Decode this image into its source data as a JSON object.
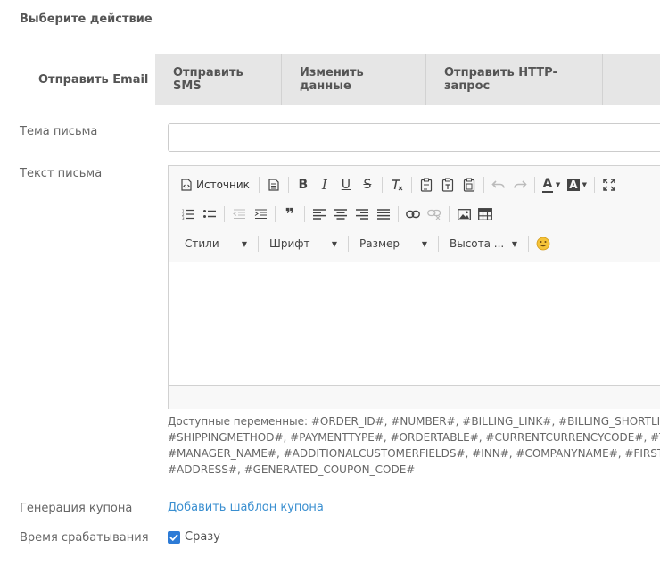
{
  "section_title": "Выберите действие",
  "tabs": [
    {
      "label": "Отправить Email",
      "active": true
    },
    {
      "label": "Отправить SMS",
      "active": false
    },
    {
      "label": "Изменить данные",
      "active": false
    },
    {
      "label": "Отправить HTTP-запрос",
      "active": false
    }
  ],
  "form": {
    "subject_label": "Тема письма",
    "subject_value": "",
    "body_label": "Текст письма",
    "coupon_label": "Генерация купона",
    "coupon_link": "Добавить шаблон купона",
    "trigger_label": "Время срабатывания",
    "trigger_checkbox_label": "Сразу",
    "trigger_checked": true
  },
  "editor": {
    "source_label": "Источник",
    "bold": "B",
    "italic": "I",
    "underline": "U",
    "strike": "S",
    "quote": "❞",
    "text_color": "A",
    "bg_color": "A",
    "combos": [
      "Стили",
      "Шрифт",
      "Размер",
      "Высота ..."
    ],
    "emoji": "😀"
  },
  "variables_lines": [
    "Доступные переменные: #ORDER_ID#, #NUMBER#, #BILLING_LINK#, #BILLING_SHORTLINK#,",
    "#SHIPPINGMETHOD#, #PAYMENTTYPE#, #ORDERTABLE#, #CURRENTCURRENCYCODE#, #TOTALPRICE#,",
    "#MANAGER_NAME#, #ADDITIONALCUSTOMERFIELDS#, #INN#, #COMPANYNAME#, #FIRSTNAME#,",
    "#ADDRESS#, #GENERATED_COUPON_CODE#"
  ],
  "colors": {
    "tab_bg": "#e6e6e6",
    "link": "#3a8fd0",
    "checkbox": "#2d7bd6"
  }
}
